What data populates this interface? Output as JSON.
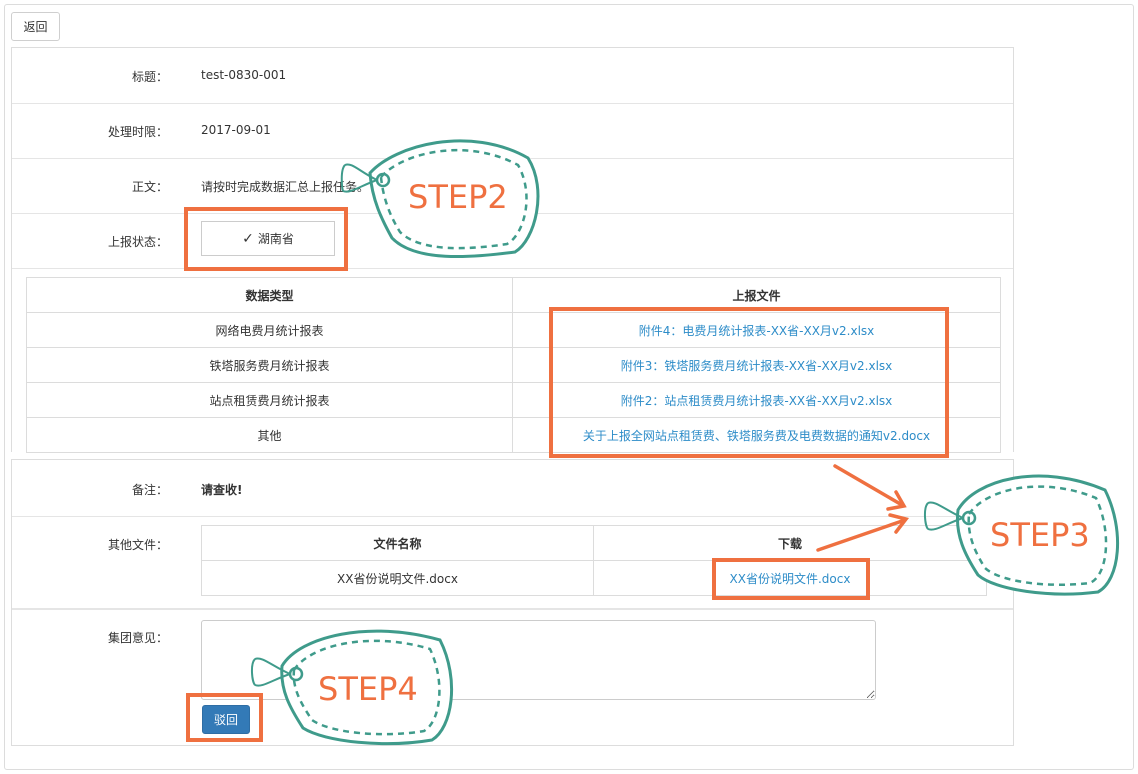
{
  "header": {
    "back_label": "返回"
  },
  "fields": {
    "title_label": "标题：",
    "title_value": "test-0830-001",
    "deadline_label": "处理时限：",
    "deadline_value": "2017-09-01",
    "body_label": "正文：",
    "body_value": "请按时完成数据汇总上报任务。",
    "status_label": "上报状态：",
    "status_check": "✓",
    "status_value": "湖南省",
    "remark_label": "备注：",
    "remark_value": "请查收!",
    "other_files_label": "其他文件：",
    "opinion_label": "集团意见："
  },
  "report_table": {
    "headers": [
      "数据类型",
      "上报文件"
    ],
    "rows": [
      {
        "type": "网络电费月统计报表",
        "file": "附件4：电费月统计报表-XX省-XX月v2.xlsx"
      },
      {
        "type": "铁塔服务费月统计报表",
        "file": "附件3：铁塔服务费月统计报表-XX省-XX月v2.xlsx"
      },
      {
        "type": "站点租赁费月统计报表",
        "file": "附件2：站点租赁费月统计报表-XX省-XX月v2.xlsx"
      },
      {
        "type": "其他",
        "file": "关于上报全网站点租赁费、铁塔服务费及电费数据的通知v2.docx"
      }
    ]
  },
  "other_files_table": {
    "headers": [
      "文件名称",
      "下载"
    ],
    "rows": [
      {
        "name": "XX省份说明文件.docx",
        "download": "XX省份说明文件.docx"
      }
    ]
  },
  "actions": {
    "reject_label": "驳回"
  },
  "annotations": {
    "step2": "STEP2",
    "step3": "STEP3",
    "step4": "STEP4",
    "highlight_color": "#ef7040",
    "tag_color": "#3f9b8b",
    "step_text_color": "#ef7040"
  }
}
